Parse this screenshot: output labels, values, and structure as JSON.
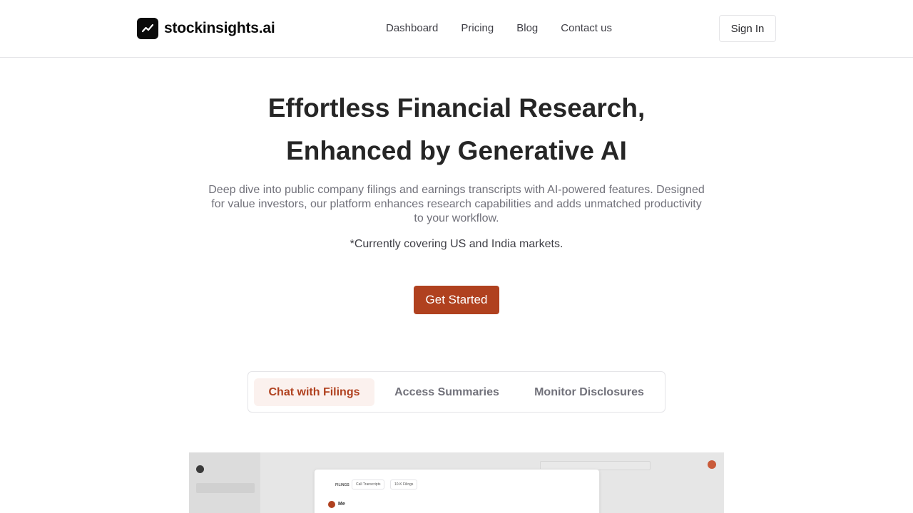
{
  "header": {
    "brand_name": "stockinsights.ai",
    "nav": [
      "Dashboard",
      "Pricing",
      "Blog",
      "Contact us"
    ],
    "signin_label": "Sign In"
  },
  "hero": {
    "title_line1": "Effortless Financial Research,",
    "title_line2": "Enhanced by Generative AI",
    "subtitle": "Deep dive into public company filings and earnings transcripts with AI-powered features. Designed for value investors, our platform enhances research capabilities and adds unmatched productivity to your workflow.",
    "note": "*Currently covering US and India markets.",
    "cta_label": "Get Started"
  },
  "tabs": [
    {
      "label": "Chat with Filings",
      "active": true
    },
    {
      "label": "Access Summaries",
      "active": false
    },
    {
      "label": "Monitor Disclosures",
      "active": false
    }
  ],
  "preview": {
    "card_label": "FILINGS",
    "chip1": "Call Transcripts",
    "chip2": "10-K Filings",
    "me_label": "Me"
  },
  "colors": {
    "accent": "#b0411f",
    "active_tab_bg": "#fbf1ee"
  }
}
